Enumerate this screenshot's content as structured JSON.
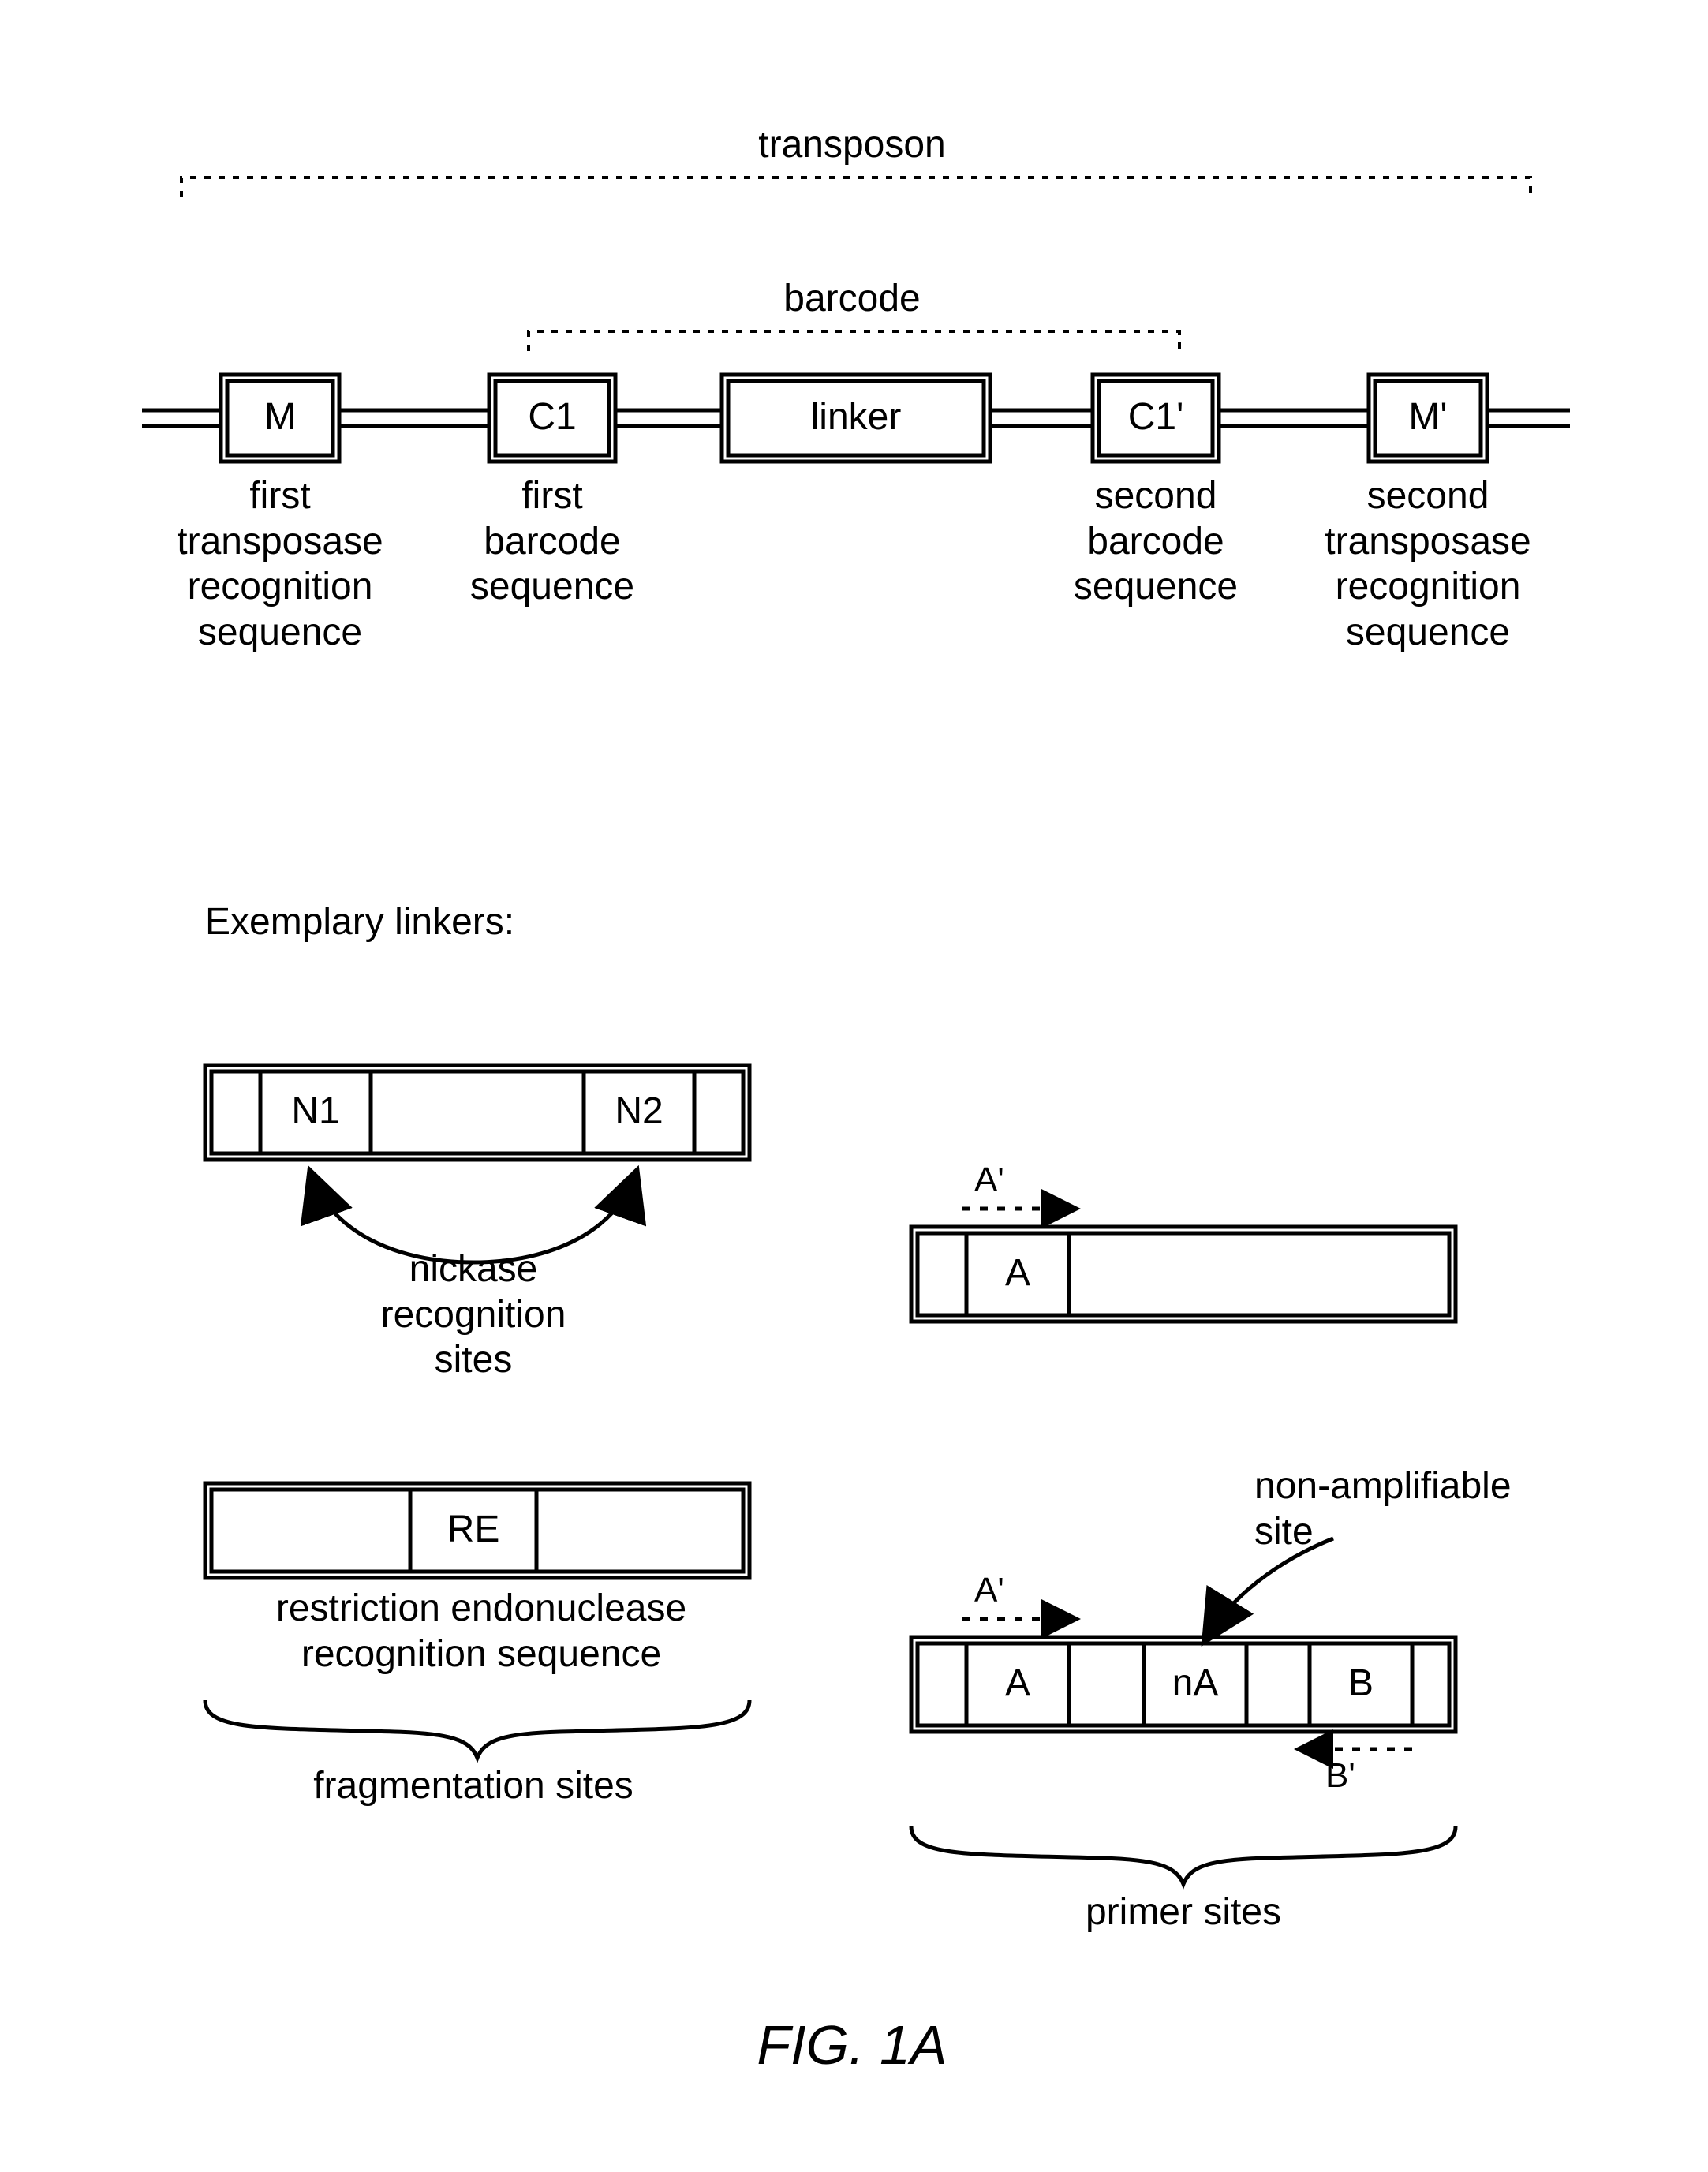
{
  "figureLabel": "FIG. 1A",
  "top": {
    "transposon": "transposon",
    "barcode": "barcode",
    "boxes": {
      "M": {
        "text": "M",
        "sub": "first\ntransposase\nrecognition\nsequence"
      },
      "C1": {
        "text": "C1",
        "sub": "first\nbarcode\nsequence"
      },
      "L": {
        "text": "linker",
        "sub": ""
      },
      "C1p": {
        "text": "C1'",
        "sub": "second\nbarcode\nsequence"
      },
      "Mp": {
        "text": "M'",
        "sub": "second\ntransposase\nrecognition\nsequence"
      }
    }
  },
  "sectionLabel": "Exemplary linkers:",
  "panel_nickase": {
    "N1": "N1",
    "N2": "N2",
    "annot": "nickase\nrecognition\nsites"
  },
  "panel_re": {
    "RE": "RE",
    "annot": "restriction endonuclease\nrecognition sequence"
  },
  "panel_Aonly": {
    "A": "A",
    "Aprime": "A'"
  },
  "panel_primer": {
    "Aprime": "A'",
    "A": "A",
    "nA": "nA",
    "B": "B",
    "Bprime": "B'",
    "nonamp": "non-amplifiable\nsite"
  },
  "fragLabel": "fragmentation sites",
  "primerLabel": "primer sites"
}
